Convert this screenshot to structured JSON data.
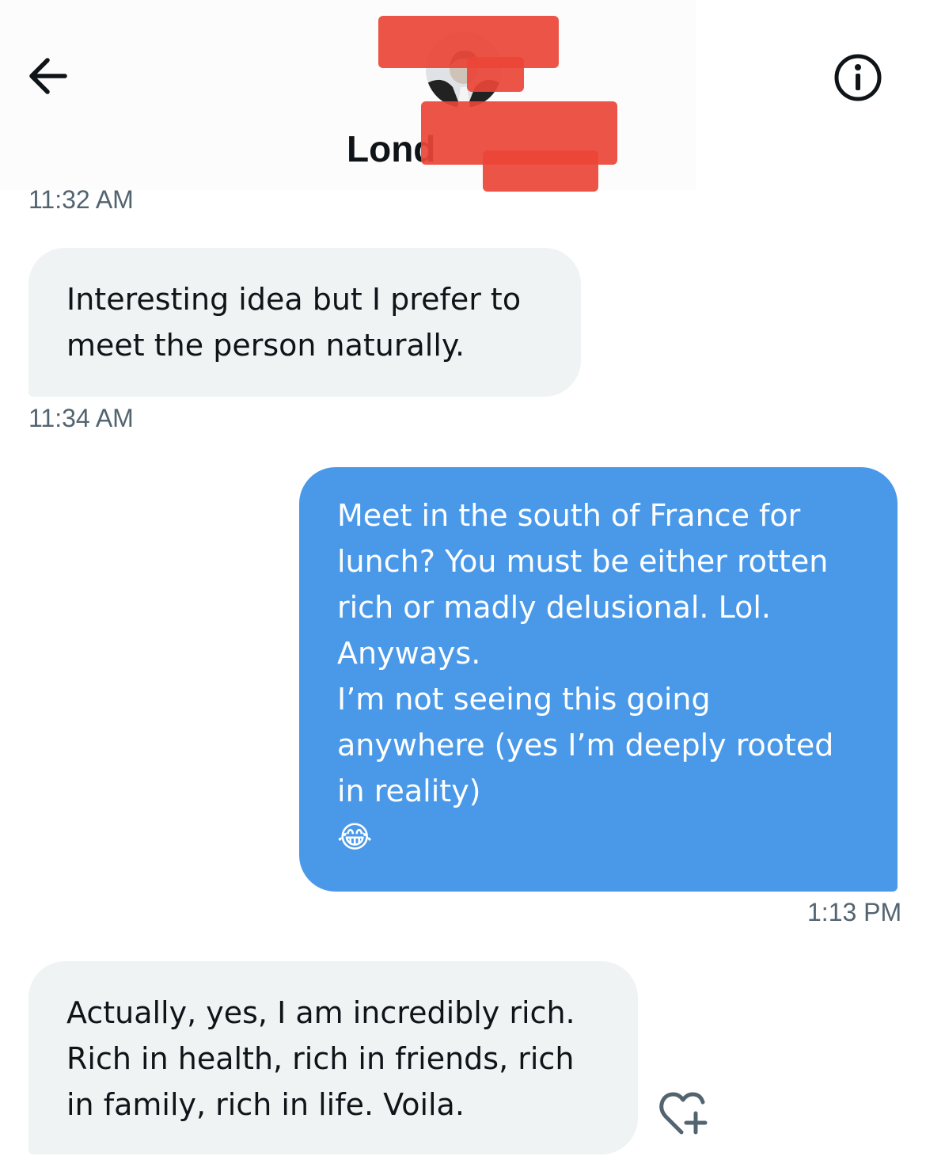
{
  "header": {
    "contact_name": "Lond",
    "back_icon": "arrow-left-icon",
    "info_icon": "info-circle-icon"
  },
  "messages": [
    {
      "direction": "incoming",
      "text": "Interesting idea but I prefer to\nmeet the person naturally.",
      "time": "11:34 AM"
    },
    {
      "direction": "outgoing",
      "text": "Meet in the south of France for\nlunch? You must be either rotten\nrich or madly delusional. Lol.\nAnyways.\nI’m not seeing this going\nanywhere (yes I’m deeply rooted\nin reality)\n😂",
      "time": "1:13 PM"
    },
    {
      "direction": "incoming",
      "text": "Actually, yes, I am incredibly rich.\nRich in health, rich in friends, rich\nin family, rich in life. Voila."
    }
  ],
  "top_timestamp": "11:32 AM",
  "reaction_icon": "heart-plus-icon",
  "colors": {
    "incoming_bubble": "#eff3f4",
    "outgoing_bubble": "#4a99e9",
    "timestamp": "#536471",
    "text": "#0f1419",
    "redaction": "#ea4537"
  }
}
